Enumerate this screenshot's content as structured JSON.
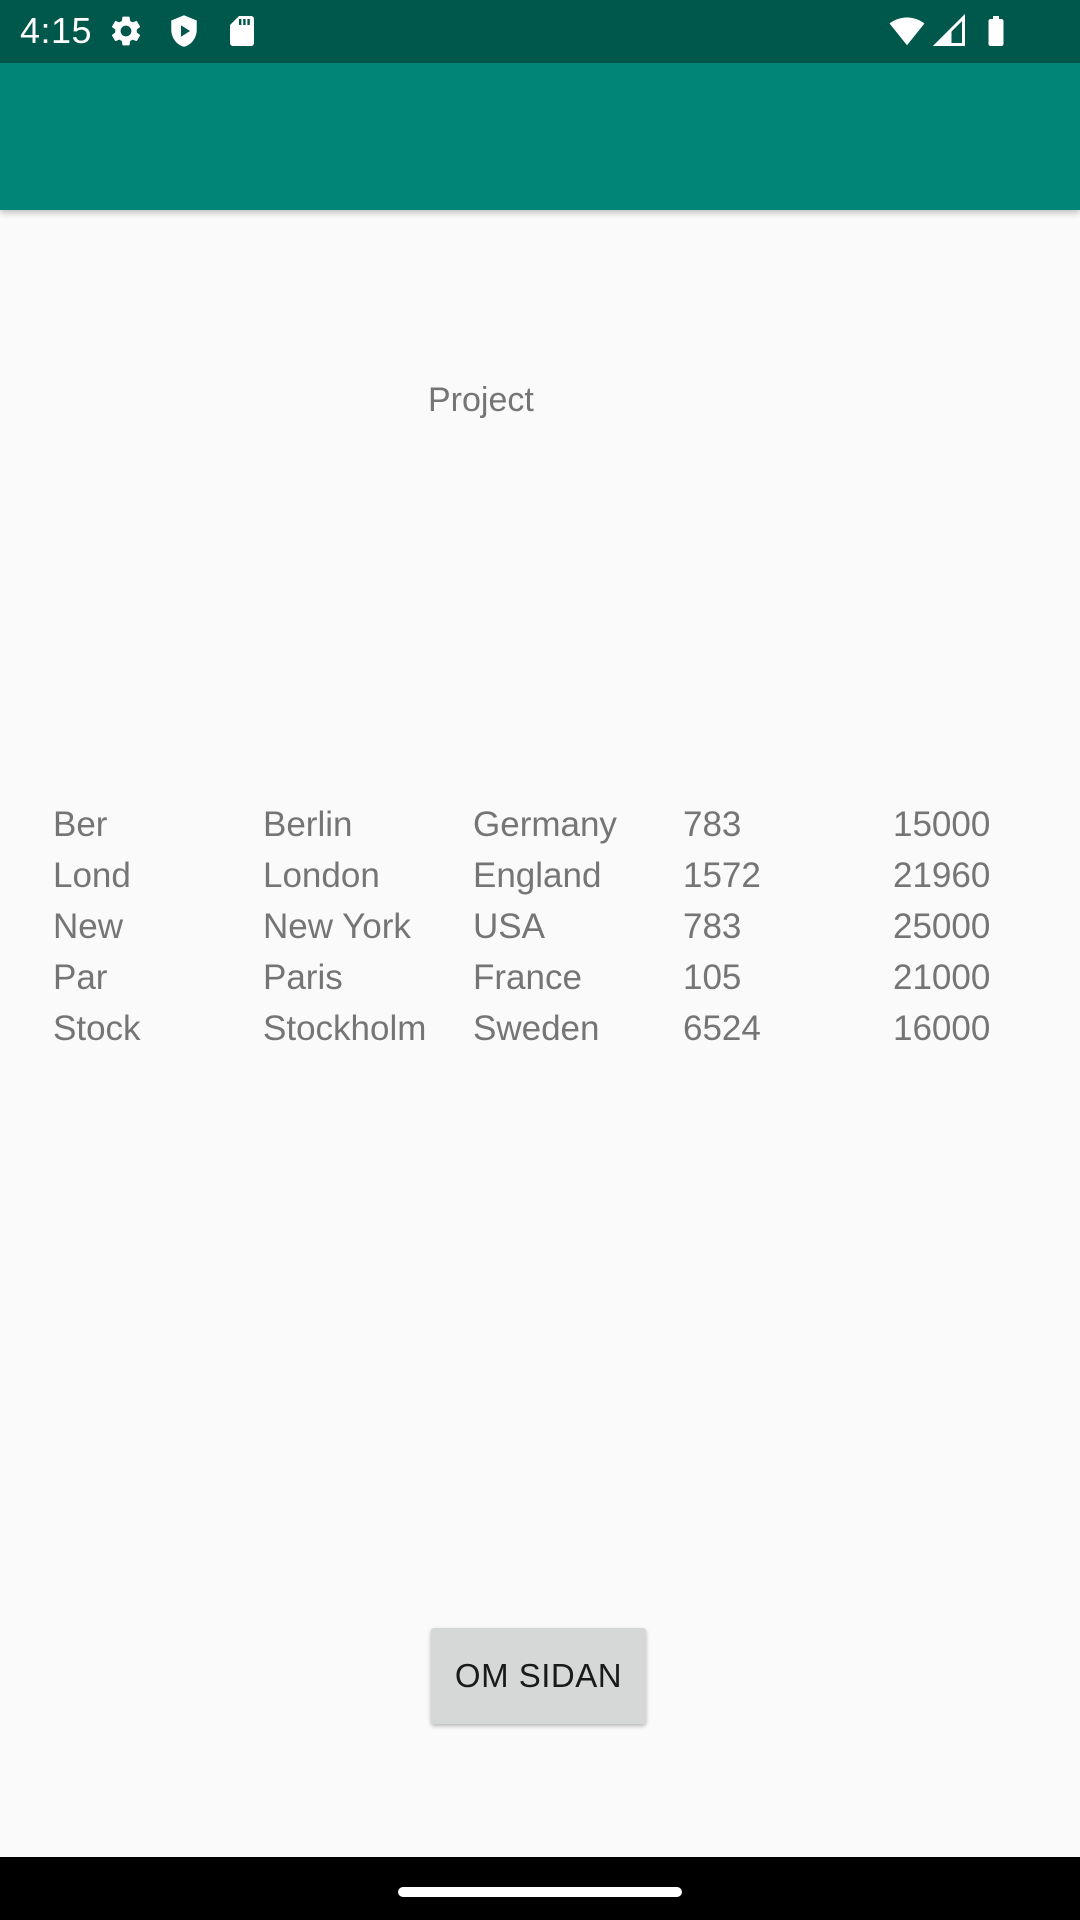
{
  "status_bar": {
    "time": "4:15",
    "left_icons": [
      "gear-icon",
      "shield-icon",
      "sd-card-icon"
    ],
    "right_icons": [
      "wifi-icon",
      "cell-signal-icon",
      "battery-icon"
    ],
    "background": "#00574b"
  },
  "app_bar": {
    "color": "#008577"
  },
  "main": {
    "title": "Project",
    "table": {
      "rows": [
        [
          "Ber",
          "Berlin",
          "Germany",
          "783",
          "15000"
        ],
        [
          "Lond",
          "London",
          "England",
          "1572",
          "21960"
        ],
        [
          "New",
          "New York",
          "USA",
          "783",
          "25000"
        ],
        [
          "Par",
          "Paris",
          "France",
          "105",
          "21000"
        ],
        [
          "Stock",
          "Stockholm",
          "Sweden",
          "6524",
          "16000"
        ]
      ]
    },
    "button": {
      "label": "OM SIDAN"
    }
  }
}
